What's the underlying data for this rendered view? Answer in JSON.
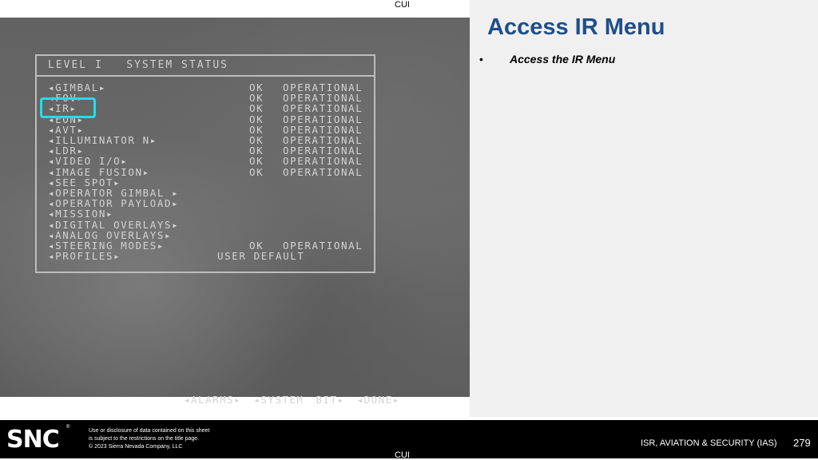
{
  "classification": "CUI",
  "menu": {
    "header": "LEVEL I   SYSTEM STATUS",
    "rows": [
      {
        "label": "◂GIMBAL▸",
        "ok": "OK",
        "status": "OPERATIONAL"
      },
      {
        "label": "◂FOV▸",
        "ok": "OK",
        "status": "OPERATIONAL"
      },
      {
        "label": "◂IR▸",
        "ok": "OK",
        "status": "OPERATIONAL"
      },
      {
        "label": "◂EON▸",
        "ok": "OK",
        "status": "OPERATIONAL"
      },
      {
        "label": "◂AVT▸",
        "ok": "OK",
        "status": "OPERATIONAL"
      },
      {
        "label": "◂ILLUMINATOR N▸",
        "ok": "OK",
        "status": "OPERATIONAL"
      },
      {
        "label": "◂LDR▸",
        "ok": "OK",
        "status": "OPERATIONAL"
      },
      {
        "label": "◂VIDEO I/O▸",
        "ok": "OK",
        "status": "OPERATIONAL"
      },
      {
        "label": "◂IMAGE FUSION▸",
        "ok": "OK",
        "status": "OPERATIONAL"
      },
      {
        "label": "◂SEE SPOT▸"
      },
      {
        "label": "◂OPERATOR GIMBAL ▸"
      },
      {
        "label": "◂OPERATOR PAYLOAD▸"
      },
      {
        "label": "◂MISSION▸"
      },
      {
        "label": "◂DIGITAL OVERLAYS▸"
      },
      {
        "label": "◂ANALOG OVERLAYS▸"
      },
      {
        "label": "◂STEERING MODES▸",
        "ok": "OK",
        "status": "OPERATIONAL"
      },
      {
        "label": "◂PROFILES▸",
        "profile": "USER DEFAULT"
      }
    ],
    "bottom": {
      "alarms": "◂ALARMS▸",
      "bit": "◂SYSTEM BIT▸",
      "done": "◂DONE▸"
    }
  },
  "panel": {
    "title": "Access IR Menu",
    "bullet": "•",
    "bullet_text": "Access the IR Menu"
  },
  "footer": {
    "logo": "SNC",
    "disclaimer": [
      "Use or disclosure of data contained on this sheet",
      "is subject to the restrictions on the title page.",
      "© 2023 Sierra Nevada Company, LLC"
    ],
    "division": "ISR, AVIATION & SECURITY (IAS)",
    "page": "279"
  },
  "colors": {
    "title": "#1f4e8c",
    "highlight": "#1fe0e8"
  }
}
